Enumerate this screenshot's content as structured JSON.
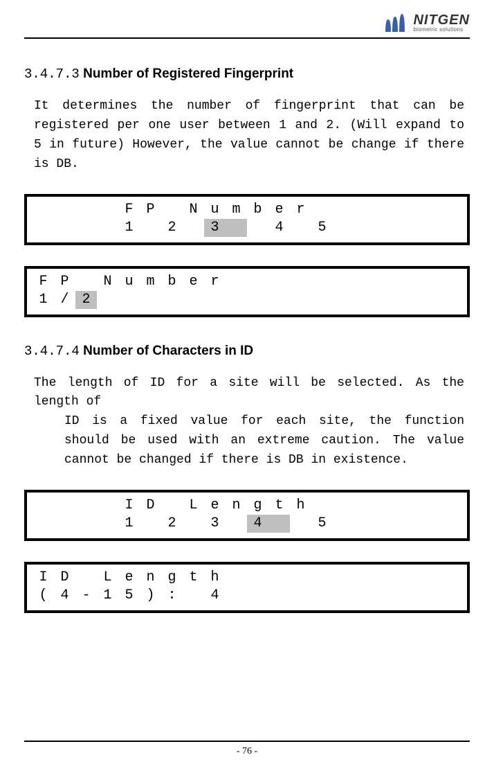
{
  "header": {
    "brand": "NITGEN",
    "tagline": "biometric solutions"
  },
  "section1": {
    "num": "3.4.7.3",
    "title": "Number of Registered Fingerprint",
    "body": "It determines the number of fingerprint that can be registered per one user between 1 and 2. (Will expand to 5 in future) However, the value cannot be change if there is DB."
  },
  "lcd1": {
    "row1": [
      "",
      "",
      "",
      "",
      "F",
      "P",
      "",
      "N",
      "u",
      "m",
      "b",
      "e",
      "r",
      "",
      "",
      "",
      ""
    ],
    "row2": [
      "",
      "",
      "",
      "",
      "1",
      "",
      "2",
      "",
      "3",
      "",
      "",
      "4",
      "",
      "5",
      "",
      "",
      ""
    ],
    "highlight_row2_cols": [
      8,
      9
    ]
  },
  "lcd2": {
    "row1": [
      "F",
      "P",
      "",
      "N",
      "u",
      "m",
      "b",
      "e",
      "r",
      "",
      "",
      "",
      "",
      "",
      "",
      "",
      ""
    ],
    "row2": [
      "1",
      "/",
      "2",
      "",
      "",
      "",
      "",
      "",
      "",
      "",
      "",
      "",
      "",
      "",
      "",
      "",
      ""
    ],
    "highlight_row2_cols": [
      2
    ]
  },
  "section2": {
    "num": "3.4.7.4",
    "title": "Number of Characters in ID",
    "body_line1": "The length of ID for a site will be selected. As the length of",
    "body_rest": "ID is a fixed value for each site, the function should be used with an extreme caution. The value cannot be changed if there is DB in existence."
  },
  "lcd3": {
    "row1": [
      "",
      "",
      "",
      "",
      "I",
      "D",
      "",
      "L",
      "e",
      "n",
      "g",
      "t",
      "h",
      "",
      "",
      "",
      ""
    ],
    "row2": [
      "",
      "",
      "",
      "",
      "1",
      "",
      "2",
      "",
      "3",
      "",
      "4",
      "",
      "",
      "5",
      "",
      "",
      ""
    ],
    "highlight_row2_cols": [
      10,
      11
    ]
  },
  "lcd4": {
    "row1": [
      "I",
      "D",
      "",
      "L",
      "e",
      "n",
      "g",
      "t",
      "h",
      "",
      "",
      "",
      "",
      "",
      "",
      "",
      ""
    ],
    "row2": [
      "(",
      "4",
      "-",
      "1",
      "5",
      ")",
      ":",
      "",
      "4",
      "",
      "",
      "",
      "",
      "",
      "",
      "",
      ""
    ],
    "highlight_row2_cols": []
  },
  "footer": {
    "page": "- 76 -"
  }
}
